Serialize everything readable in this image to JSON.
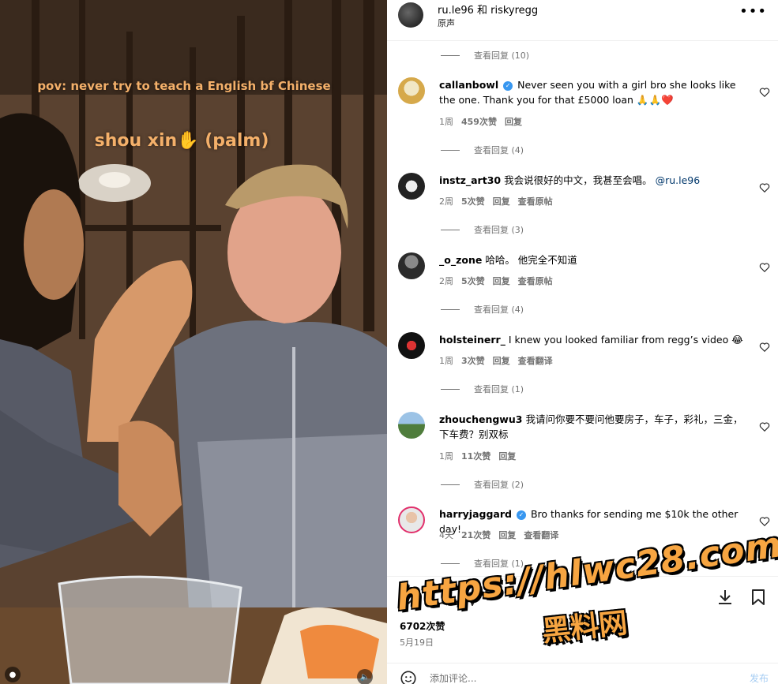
{
  "video": {
    "caption_line1": "pov: never try to teach a English bf Chinese",
    "caption_line2": "shou xin✋ (palm)"
  },
  "header": {
    "title": "ru.le96 和 riskyregg",
    "subtitle": "原声",
    "more_icon": "more-horizontal-icon"
  },
  "comments": [
    {
      "replies_above": "查看回复 (10)"
    },
    {
      "user": "callanbowl",
      "verified": true,
      "text": "Never seen you with a girl bro she looks like the one. Thank you for that £5000 loan 🙏🙏❤️",
      "age": "1周",
      "likes": "459次赞",
      "reply": "回复",
      "view_replies": "查看回复 (4)"
    },
    {
      "user": "instz_art30",
      "verified": false,
      "text": "我会说很好的中文，我甚至会唱。",
      "mention": "@ru.le96",
      "age": "2周",
      "likes": "5次赞",
      "reply": "回复",
      "extra": "查看原帖",
      "view_replies": "查看回复 (3)"
    },
    {
      "user": "_o_zone",
      "verified": false,
      "text": "哈哈。 他完全不知道",
      "age": "2周",
      "likes": "5次赞",
      "reply": "回复",
      "extra": "查看原帖",
      "view_replies": "查看回复 (4)"
    },
    {
      "user": "holsteinerr_",
      "verified": false,
      "text": "I knew you looked familiar from regg’s video 😂",
      "age": "1周",
      "likes": "3次赞",
      "reply": "回复",
      "extra": "查看翻译",
      "view_replies": "查看回复 (1)"
    },
    {
      "user": "zhouchengwu3",
      "verified": false,
      "text": "我请问你要不要问他要房子，车子，彩礼，三金，下车费？别双标",
      "age": "1周",
      "likes": "11次赞",
      "reply": "回复",
      "view_replies": "查看回复 (2)"
    },
    {
      "user": "harryjaggard",
      "verified": true,
      "text": "Bro thanks for sending me $10k the other day!",
      "age": "4天",
      "likes": "21次赞",
      "reply": "回复",
      "extra": "查看翻译",
      "view_replies": "查看回复 (1)"
    }
  ],
  "action_bar": {
    "like_icon": "heart-icon",
    "comment_icon": "comment-icon",
    "share_icon": "share-icon",
    "download_icon": "download-icon",
    "save_icon": "bookmark-icon"
  },
  "likes": "6702次赞",
  "date": "5月19日",
  "add_comment": {
    "placeholder": "添加评论...",
    "post_label": "发布"
  },
  "watermark": {
    "line1": "https://hlwc28.com",
    "line2": "黑料网"
  },
  "colors": {
    "verified": "#3897f0",
    "watermark": "#f7a541",
    "caption": "#f4b06a",
    "post_button": "#a6cdf3"
  }
}
